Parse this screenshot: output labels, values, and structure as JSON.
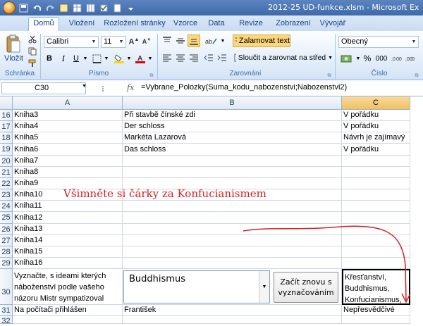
{
  "window": {
    "title": "2012-25 UD-funkce.xlsm - Microsoft Ex"
  },
  "ribbon": {
    "tabs": [
      "Domů",
      "Vložení",
      "Rozložení stránky",
      "Vzorce",
      "Data",
      "Revize",
      "Zobrazení",
      "Vývojář"
    ],
    "active_tab": "Domů",
    "clipboard": {
      "paste_label": "Vložit",
      "group_label": "Schránka"
    },
    "font": {
      "name": "Calibri",
      "size": "11",
      "bold": "B",
      "italic": "I",
      "underline": "U",
      "group_label": "Písmo"
    },
    "alignment": {
      "wrap_label": "Zalamovat text",
      "merge_label": "Sloučit a zarovnat na střed",
      "group_label": "Zarovnání"
    },
    "number": {
      "format": "Obecný",
      "percent": "%",
      "thousands": "000",
      "group_label": "Číslo"
    }
  },
  "formula_bar": {
    "name_box": "C30",
    "fx": "fx",
    "formula": "=Vybrane_Polozky(Suma_kodu_nabozenstvi;Nabozenstvi2)"
  },
  "columns": [
    "A",
    "B",
    "C"
  ],
  "selected_column": "C",
  "rows": [
    {
      "num": "16",
      "a": "Kniha3",
      "b": "Při stavbě čínské zdi",
      "c": "V pořádku"
    },
    {
      "num": "17",
      "a": "Kniha4",
      "b": "Der schloss",
      "c": "V pořádku"
    },
    {
      "num": "18",
      "a": "Kniha5",
      "b": "Markéta Lazarová",
      "c": "Návrh je zajímavý"
    },
    {
      "num": "19",
      "a": "Kniha6",
      "b": "Das schloss",
      "c": "V pořádku"
    },
    {
      "num": "20",
      "a": "Kniha7",
      "b": "",
      "c": ""
    },
    {
      "num": "21",
      "a": "Kniha8",
      "b": "",
      "c": ""
    },
    {
      "num": "22",
      "a": "Kniha9",
      "b": "",
      "c": ""
    },
    {
      "num": "23",
      "a": "Kniha10",
      "b": "",
      "c": ""
    },
    {
      "num": "24",
      "a": "Kniha11",
      "b": "",
      "c": ""
    },
    {
      "num": "25",
      "a": "Kniha12",
      "b": "",
      "c": ""
    },
    {
      "num": "26",
      "a": "Kniha13",
      "b": "",
      "c": ""
    },
    {
      "num": "27",
      "a": "Kniha14",
      "b": "",
      "c": ""
    },
    {
      "num": "28",
      "a": "Kniha15",
      "b": "",
      "c": ""
    },
    {
      "num": "29",
      "a": "Kniha16",
      "b": "",
      "c": ""
    }
  ],
  "row30": {
    "num": "30",
    "a_lines": [
      "Vyznačte, s ideami kterých",
      "náboženství podle vašeho",
      "názoru Mistr sympatizoval"
    ],
    "c_lines": [
      "Křesťanství,",
      "Buddhismus,",
      "Konfucianismus,"
    ]
  },
  "row31": {
    "num": "31",
    "a": "Na počítači přihlášen",
    "b": "František",
    "c": "Nepřesvědčivé"
  },
  "row32": {
    "num": "32"
  },
  "combo_control": {
    "value": "Buddhismus"
  },
  "reset_button": {
    "lines": [
      "Začít znovu s",
      "vyznačováním"
    ]
  },
  "annotation": {
    "text": "Všimněte si čárky za Konfucianismem",
    "color": "#d62020"
  }
}
